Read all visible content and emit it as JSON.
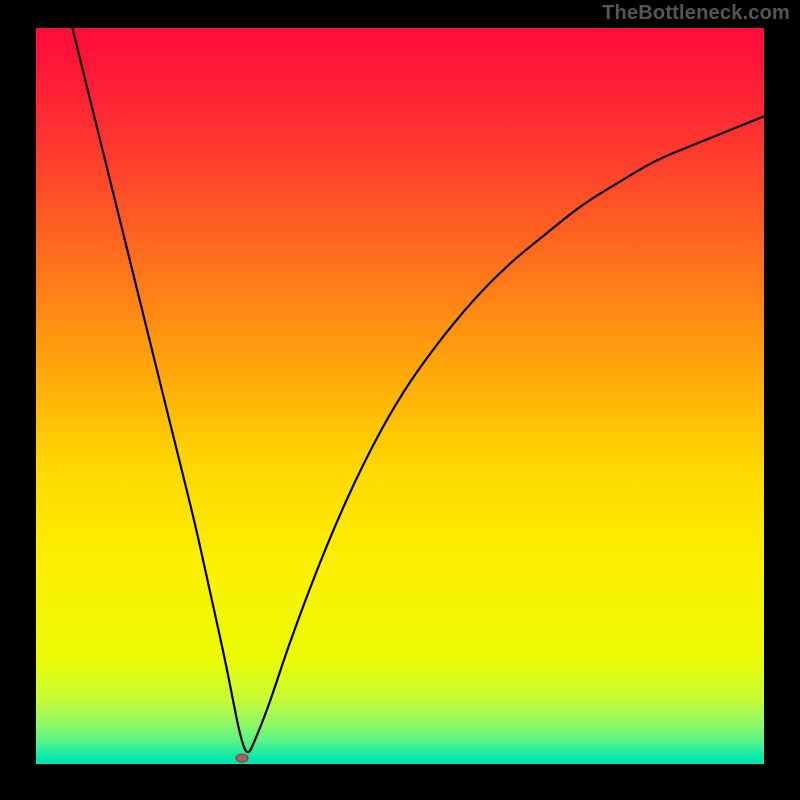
{
  "watermark": "TheBottleneck.com",
  "chart_data": {
    "type": "line",
    "title": "",
    "xlabel": "",
    "ylabel": "",
    "xlim": [
      0,
      100
    ],
    "ylim": [
      0,
      100
    ],
    "grid": false,
    "legend": false,
    "series": [
      {
        "name": "bottleneck-curve",
        "x": [
          5,
          10,
          15,
          20,
          22,
          24,
          26,
          27,
          28,
          29,
          30,
          32,
          35,
          40,
          45,
          50,
          55,
          60,
          65,
          70,
          75,
          80,
          85,
          90,
          95,
          100
        ],
        "y": [
          100,
          80,
          60,
          40,
          32,
          23,
          14,
          9,
          4,
          1,
          3,
          8,
          17,
          30,
          41,
          50,
          57,
          63,
          68,
          72,
          76,
          79,
          82,
          84,
          86,
          88
        ]
      }
    ],
    "marker": {
      "x": 28.3,
      "y": 0.8
    },
    "background_gradient": {
      "direction": "vertical",
      "stops": [
        {
          "pos": 0,
          "color": "#ff0b3b"
        },
        {
          "pos": 50,
          "color": "#ffd900"
        },
        {
          "pos": 97,
          "color": "#56f38a"
        },
        {
          "pos": 100,
          "color": "#04e2b0"
        }
      ]
    }
  }
}
